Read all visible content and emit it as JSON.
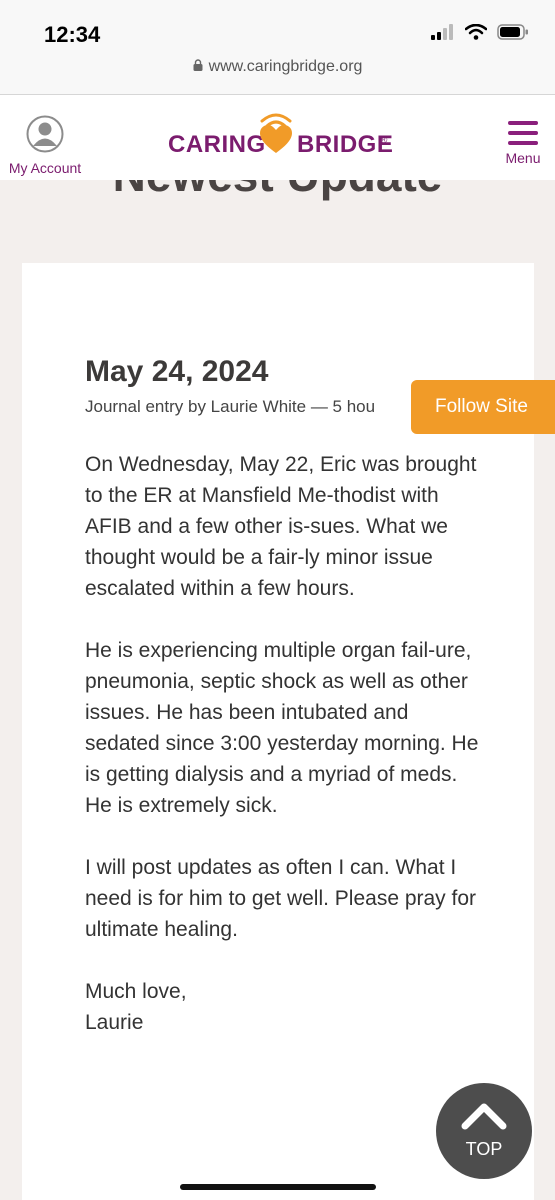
{
  "status_bar": {
    "time": "12:34"
  },
  "browser": {
    "url": "www.caringbridge.org"
  },
  "header": {
    "account_label": "My Account",
    "logo_left": "CARING",
    "logo_right": "BRIDGE",
    "logo_mark": "®",
    "menu_label": "Menu",
    "brand_color": "#7b1c6e",
    "accent_color": "#f19b28"
  },
  "page_heading": "Newest Update",
  "entry": {
    "date": "May 24, 2024",
    "byline": "Journal entry by Laurie White — 5 hou",
    "paragraphs": [
      "On Wednesday, May 22, Eric was brought to the ER at Mansfield Me-thodist with AFIB and a few other is-sues. What we thought would be a fair-ly minor issue escalated within a few hours.",
      "He is experiencing multiple organ fail-ure, pneumonia, septic shock as well as other issues. He has been intubated and sedated since 3:00 yesterday morning.  He is getting dialysis and a myriad of meds. He is extremely sick.",
      "I will post updates as often I can. What I need is for him to get well. Please pray for ultimate healing."
    ],
    "closing": "Much love,",
    "signature": "Laurie"
  },
  "follow_button": "Follow Site",
  "top_button": "TOP"
}
